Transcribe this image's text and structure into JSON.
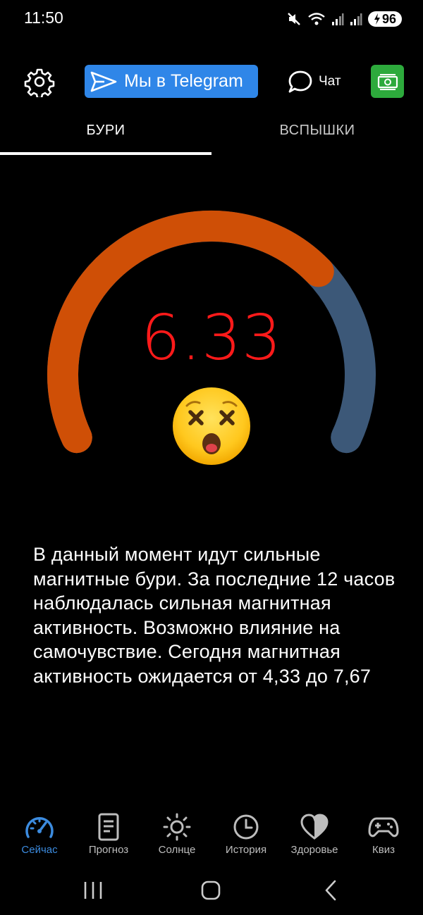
{
  "status_bar": {
    "time": "11:50",
    "battery": "96",
    "icons": [
      "mute-icon",
      "wifi-icon",
      "signal-icon",
      "signal-icon",
      "battery-charging-icon"
    ]
  },
  "top_bar": {
    "settings_icon": "gear-icon",
    "telegram_label": "Мы в Telegram",
    "chat_label": "Чат",
    "money_icon": "banknote-icon",
    "telegram_color": "#2f86e8",
    "money_color": "#2daa3c"
  },
  "tabs": [
    {
      "label": "БУРИ",
      "active": true
    },
    {
      "label": "ВСПЫШКИ",
      "active": false
    }
  ],
  "gauge": {
    "value": "6.33",
    "value_color": "#ff1a1a",
    "fill_color": "#cf4f06",
    "track_color": "#3c5878",
    "fill_fraction": 0.7,
    "emoji": "dizzy-face-emoji"
  },
  "description": "В данный момент идут сильные магнитные бури. За последние 12 часов наблюдалась сильная магнитная активность. Возможно влияние на самочувствие. Сегодня магнитная активность ожидается от 4,33 до 7,67",
  "bottom_nav": {
    "active_color": "#3c8ce0",
    "items": [
      {
        "label": "Сейчас",
        "icon": "gauge-icon",
        "active": true
      },
      {
        "label": "Прогноз",
        "icon": "document-icon",
        "active": false
      },
      {
        "label": "Солнце",
        "icon": "sun-icon",
        "active": false
      },
      {
        "label": "История",
        "icon": "clock-icon",
        "active": false
      },
      {
        "label": "Здоровье",
        "icon": "heart-icon",
        "active": false
      },
      {
        "label": "Квиз",
        "icon": "gamepad-icon",
        "active": false
      }
    ]
  },
  "system_nav": {
    "icons": [
      "recent-apps-icon",
      "home-icon",
      "back-icon"
    ]
  }
}
